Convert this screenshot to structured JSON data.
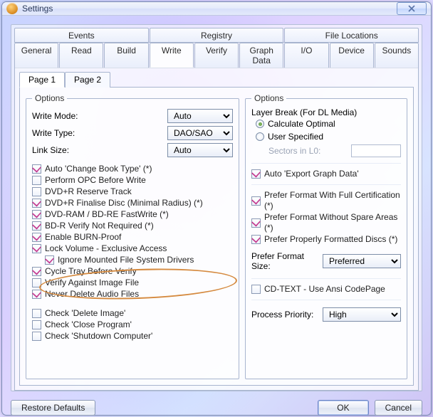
{
  "window": {
    "title": "Settings"
  },
  "mainTabs": {
    "row1": [
      "Events",
      "Registry",
      "File Locations"
    ],
    "row2": [
      "General",
      "Read",
      "Build",
      "Write",
      "Verify",
      "Graph Data",
      "I/O",
      "Device",
      "Sounds"
    ],
    "activeRow2": "Write"
  },
  "pageTabs": {
    "tabs": [
      "Page 1",
      "Page 2"
    ],
    "active": "Page 1"
  },
  "left": {
    "legend": "Options",
    "writeMode": {
      "label": "Write Mode:",
      "value": "Auto"
    },
    "writeType": {
      "label": "Write Type:",
      "value": "DAO/SAO"
    },
    "linkSize": {
      "label": "Link Size:",
      "value": "Auto"
    },
    "checks": [
      {
        "label": "Auto 'Change Book Type' (*)",
        "checked": true
      },
      {
        "label": "Perform OPC Before Write",
        "checked": false
      },
      {
        "label": "DVD+R Reserve Track",
        "checked": false
      },
      {
        "label": "DVD+R Finalise Disc (Minimal Radius) (*)",
        "checked": true
      },
      {
        "label": "DVD-RAM / BD-RE FastWrite (*)",
        "checked": true
      },
      {
        "label": "BD-R Verify Not Required (*)",
        "checked": true
      },
      {
        "label": "Enable BURN-Proof",
        "checked": true
      },
      {
        "label": "Lock Volume - Exclusive Access",
        "checked": true
      },
      {
        "label": "Ignore Mounted File System Drivers",
        "checked": true,
        "indent": true
      },
      {
        "label": "Cycle Tray Before Verify",
        "checked": true
      },
      {
        "label": "Verify Against Image File",
        "checked": false
      },
      {
        "label": "Never Delete Audio Files",
        "checked": true
      }
    ],
    "checks2": [
      {
        "label": "Check 'Delete Image'",
        "checked": false
      },
      {
        "label": "Check 'Close Program'",
        "checked": false
      },
      {
        "label": "Check 'Shutdown Computer'",
        "checked": false
      }
    ]
  },
  "right": {
    "legend": "Options",
    "layerBreak": {
      "label": "Layer Break (For DL Media)",
      "optCalc": "Calculate Optimal",
      "optUser": "User Specified",
      "sectorsLabel": "Sectors in L0:"
    },
    "exportGraph": {
      "label": "Auto 'Export Graph Data'",
      "checked": true
    },
    "prefer": [
      {
        "label": "Prefer Format With Full Certification (*)",
        "checked": true
      },
      {
        "label": "Prefer Format Without Spare Areas (*)",
        "checked": true
      },
      {
        "label": "Prefer Properly Formatted Discs (*)",
        "checked": true
      }
    ],
    "preferFormatSize": {
      "label": "Prefer Format Size:",
      "value": "Preferred"
    },
    "cdtext": {
      "label": "CD-TEXT - Use Ansi CodePage",
      "checked": false
    },
    "priority": {
      "label": "Process Priority:",
      "value": "High"
    }
  },
  "buttons": {
    "restore": "Restore Defaults",
    "ok": "OK",
    "cancel": "Cancel"
  }
}
